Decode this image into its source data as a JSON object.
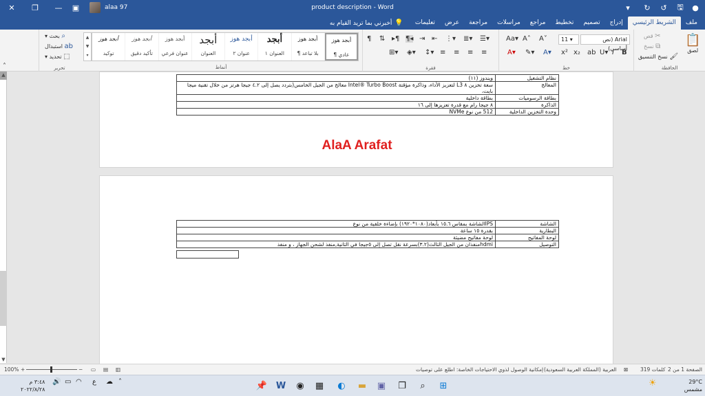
{
  "titlebar": {
    "title": "product description  -  Word",
    "user": "alaa 97",
    "colors": {
      "bg": "#2b579a"
    }
  },
  "tabs": {
    "items": [
      "ملف",
      "الشريط الرئيسي",
      "إدراج",
      "تصميم",
      "تخطيط",
      "مراجع",
      "مراسلات",
      "مراجعة",
      "عرض",
      "تعليمات"
    ],
    "tell_me": "أخبرني بما تريد القيام به"
  },
  "ribbon": {
    "clipboard": {
      "label": "الحافظة",
      "paste": "لصق",
      "cut": "قص",
      "copy": "نسخ",
      "format_painter": "نسخ التنسيق"
    },
    "font": {
      "label": "خط",
      "font_name": "Arial (نص أساسي)",
      "font_size": "11"
    },
    "paragraph": {
      "label": "فقرة"
    },
    "styles": {
      "label": "أنماط",
      "items": [
        {
          "preview": "أبجد هوز",
          "name": "¶ عادي"
        },
        {
          "preview": "أبجد هوز",
          "name": "¶ بلا تباعد"
        },
        {
          "preview": "أبجد",
          "name": "العنوان ١"
        },
        {
          "preview": "أبجد هوز",
          "name": "عنوان ٢"
        },
        {
          "preview": "أبجد",
          "name": "العنوان"
        },
        {
          "preview": "أبجد هوز",
          "name": "عنوان فرعي"
        },
        {
          "preview": "أبجد هوز",
          "name": "تأكيد دقيق"
        },
        {
          "preview": "أبجد هوز",
          "name": "توكيد"
        }
      ]
    },
    "editing": {
      "label": "تحرير",
      "find": "بحث",
      "replace": "استبدال",
      "select": "تحديد"
    }
  },
  "document": {
    "table1": [
      {
        "key": "نظام التشغيل",
        "value": "ويندوز (١١)"
      },
      {
        "key": "المعالج",
        "value": "سعة تخزين ٨ L3 لتعزيز الأداء، وذاكرة مؤقتة Intel® Turbo Boost معالج من الجيل الخامس(بتردد يصل إلى ٤.٢ جيجا هرتز من خلال تقنية ميجا بايت،"
      },
      {
        "key": "بطاقة الرسوميات",
        "value": "بطاقة داخلية"
      },
      {
        "key": "الذاكرة",
        "value": "٨ جيجا رام مع قدرة تعزيزها إلى ١٦"
      },
      {
        "key": "وحدة التخزين الداخلية",
        "value": "512 من نوع NVMe"
      }
    ],
    "signature": "AlaA Arafat",
    "table2": [
      {
        "key": "الشاشة",
        "value": "IPSالشاشة بمقاس ١٥.٦ بأبعاد(١٠٨٠*١٩٢٠) بإضاءة خلفية من نوع"
      },
      {
        "key": "البطارية",
        "value": "بقدرة ١٥ ساعة"
      },
      {
        "key": "لوحة المفاتيح",
        "value": "لوحة مفاتيح مضيئة"
      },
      {
        "key": "التوصيل",
        "value": "hdmiمنفذان من الجيل الثالث(٣.٢)بسرعة نقل تصل إلى ٥جيجا في الثانية,منفذ لشحن الجهاز ، و منفذ"
      }
    ]
  },
  "statusbar": {
    "page": "الصفحة 1 من 2",
    "words": "319 كلمات",
    "language": "العربية (المملكة العربية السعودية)",
    "accessibility": "إمكانية الوصول لذوي الاحتياجات الخاصة: اطلع على توصيات",
    "zoom": "100%"
  },
  "taskbar": {
    "time": "٣:٤٨ م",
    "date": "٢٠٢٢/٨/٢٨",
    "temperature": "29°C",
    "weather": "مشمس"
  }
}
